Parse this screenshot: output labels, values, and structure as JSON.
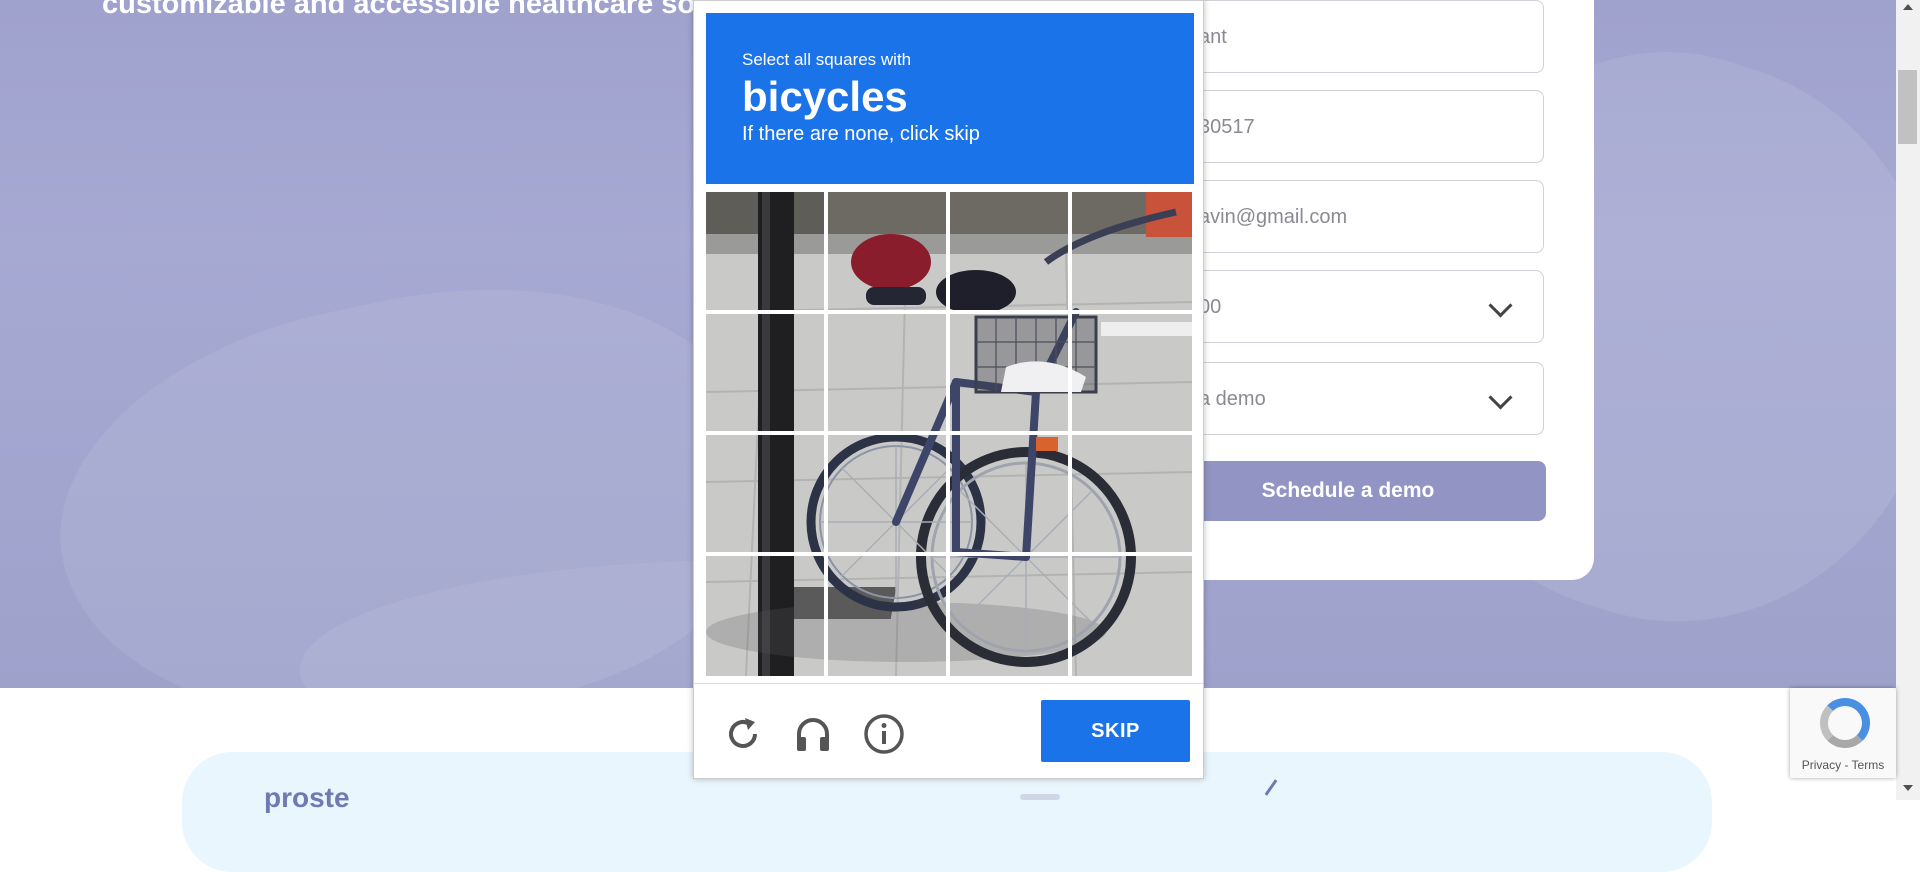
{
  "hero": {
    "tagline": "customizable and accessible healthcare solu"
  },
  "form": {
    "fields": [
      {
        "value": "ant"
      },
      {
        "value": "30517"
      },
      {
        "value": "avin@gmail.com"
      },
      {
        "value": "00"
      },
      {
        "value": "a demo"
      }
    ],
    "submit_label": "Schedule a demo"
  },
  "band": {
    "text": "proste"
  },
  "recaptcha_badge": {
    "links": "Privacy - Terms"
  },
  "captcha": {
    "instruction": "Select all squares with",
    "target": "bicycles",
    "subtext": "If there are none, click skip",
    "skip_label": "SKIP",
    "controls": [
      "refresh-icon",
      "audio-icon",
      "info-icon"
    ],
    "header_color": "#1a73e8"
  },
  "colors": {
    "hero_bg": "#a3a6cf",
    "button_bg": "#9294c4",
    "accent_blue": "#1a73e8"
  }
}
